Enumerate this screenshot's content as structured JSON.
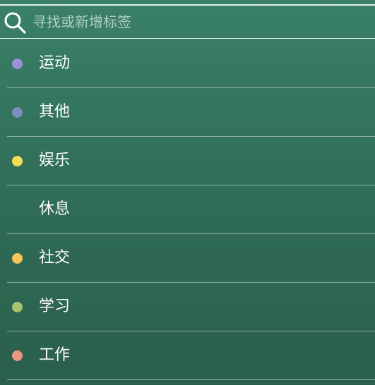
{
  "search": {
    "placeholder": "寻找或新增标签",
    "value": ""
  },
  "tags": [
    {
      "label": "运动",
      "color": "#9b8fdb"
    },
    {
      "label": "其他",
      "color": "#7d90bd"
    },
    {
      "label": "娱乐",
      "color": "#f7dd55"
    },
    {
      "label": "休息",
      "color": null
    },
    {
      "label": "社交",
      "color": "#f5c45a"
    },
    {
      "label": "学习",
      "color": "#a8c46f"
    },
    {
      "label": "工作",
      "color": "#ef9585"
    }
  ]
}
